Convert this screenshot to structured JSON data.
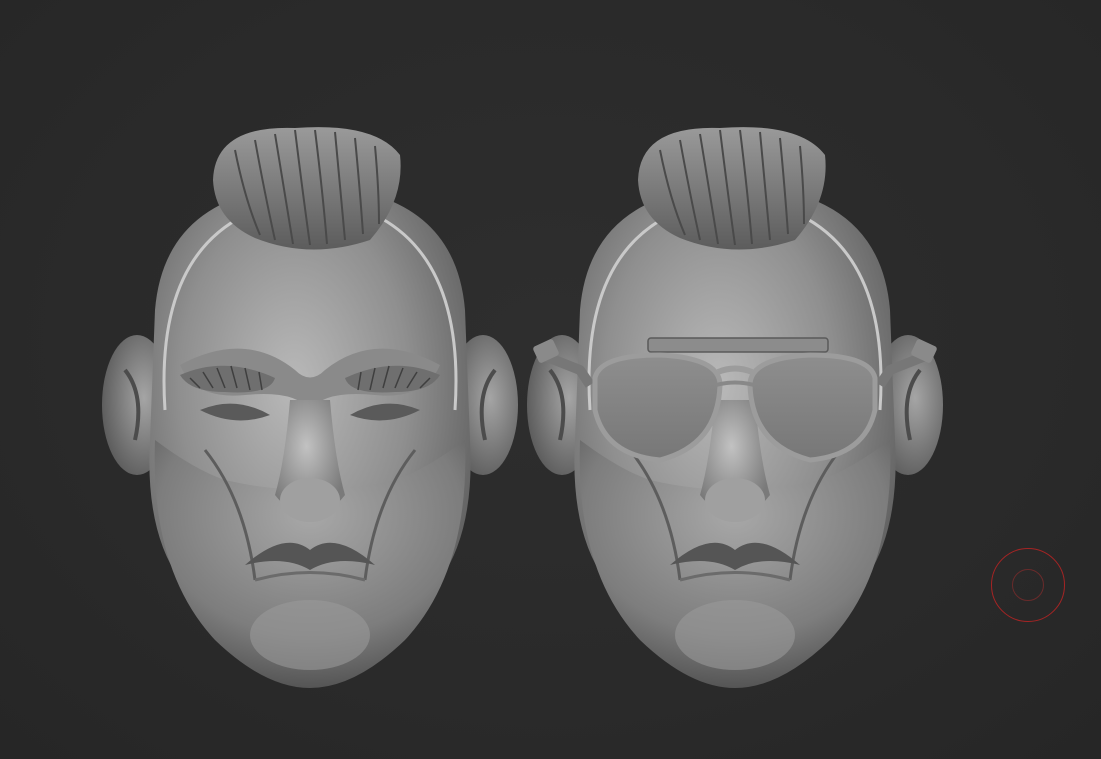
{
  "viewport": {
    "background_color": "#2a2a2a",
    "brush_color": "#a52424"
  },
  "models": [
    {
      "id": "head-base",
      "icon": "sculpt-head-icon"
    },
    {
      "id": "head-sunglasses",
      "icon": "sculpt-head-with-sunglasses-icon"
    }
  ]
}
